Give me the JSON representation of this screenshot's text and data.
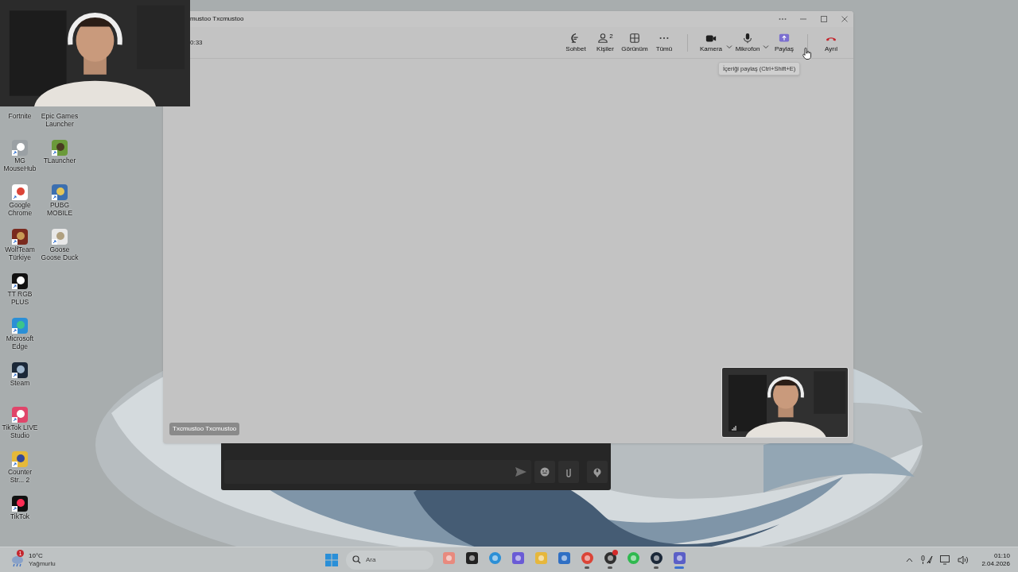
{
  "desktop_icons": [
    {
      "icons": [
        {
          "label": "Fortnite",
          "kind": "label_only"
        },
        {
          "label": "Epic Games Launcher",
          "kind": "label_only"
        }
      ]
    },
    {
      "icons": [
        {
          "label": "MG MouseHub",
          "kind": "shortcut"
        },
        {
          "label": "TLauncher",
          "kind": "shortcut"
        }
      ]
    },
    {
      "icons": [
        {
          "label": "Google Chrome",
          "kind": "shortcut"
        },
        {
          "label": "PUBG MOBILE",
          "kind": "shortcut"
        }
      ]
    },
    {
      "icons": [
        {
          "label": "WolfTeam Türkiye",
          "kind": "shortcut"
        },
        {
          "label": "Goose Goose Duck",
          "kind": "shortcut"
        }
      ]
    },
    {
      "icons": [
        {
          "label": "TT RGB PLUS",
          "kind": "shortcut"
        }
      ]
    },
    {
      "icons": [
        {
          "label": "Microsoft Edge",
          "kind": "shortcut"
        }
      ]
    },
    {
      "icons": [
        {
          "label": "Steam",
          "kind": "shortcut"
        }
      ]
    },
    {
      "icons": [
        {
          "label": "TikTok LIVE Studio",
          "kind": "shortcut"
        }
      ]
    },
    {
      "icons": [
        {
          "label": "Counter Str... 2",
          "kind": "shortcut"
        }
      ]
    },
    {
      "icons": [
        {
          "label": "TikTok",
          "kind": "shortcut"
        }
      ]
    }
  ],
  "teams_window": {
    "title": "mustoo Txcmustoo",
    "timer": "0:33",
    "toolbar": [
      {
        "label": "Sohbet",
        "dropdown": false
      },
      {
        "label": "Kişiler",
        "count": "2",
        "dropdown": false
      },
      {
        "label": "Görünüm",
        "dropdown": false
      },
      {
        "label": "Tümü",
        "dropdown": false
      },
      {
        "label": "Kamera",
        "dropdown": true
      },
      {
        "label": "Mikrofon",
        "dropdown": true
      },
      {
        "label": "Paylaş",
        "dropdown": false
      },
      {
        "label": "Ayrıl",
        "dropdown": false
      }
    ],
    "tooltip": "İçeriği paylaş (Ctrl+Shift+E)",
    "participant_name": "Txcmustoo Txcmustoo"
  },
  "taskbar": {
    "weather": {
      "badge": "1",
      "temperature": "10°C",
      "condition": "Yağmurlu"
    },
    "search": {
      "placeholder": "Ara"
    },
    "apps": [
      {
        "running": false,
        "selected": false,
        "notification": false
      },
      {
        "running": false,
        "selected": false,
        "notification": false
      },
      {
        "running": false,
        "selected": false,
        "notification": false
      },
      {
        "running": false,
        "selected": false,
        "notification": false
      },
      {
        "running": false,
        "selected": false,
        "notification": false
      },
      {
        "running": false,
        "selected": false,
        "notification": false
      },
      {
        "running": true,
        "selected": false,
        "notification": false
      },
      {
        "running": true,
        "selected": false,
        "notification": true
      },
      {
        "running": false,
        "selected": false,
        "notification": false
      },
      {
        "running": true,
        "selected": false,
        "notification": false
      },
      {
        "running": true,
        "selected": true,
        "notification": false
      }
    ],
    "clock": {
      "time": "01:10",
      "date": "2.04.2026"
    }
  }
}
